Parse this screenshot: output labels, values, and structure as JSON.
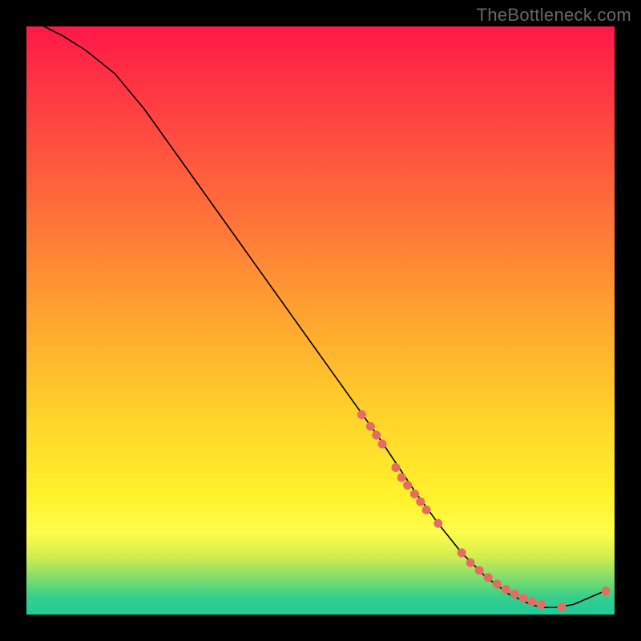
{
  "watermark": "TheBottleneck.com",
  "chart_data": {
    "type": "line",
    "title": "",
    "xlabel": "",
    "ylabel": "",
    "xlim": [
      0,
      100
    ],
    "ylim": [
      0,
      100
    ],
    "grid": false,
    "legend": false,
    "curve": {
      "x": [
        3,
        6,
        10,
        15,
        20,
        25,
        30,
        35,
        40,
        45,
        50,
        55,
        60,
        63,
        66,
        70,
        74,
        78,
        82,
        86,
        88,
        90,
        93,
        96,
        99
      ],
      "y": [
        100,
        98.5,
        96,
        92,
        86,
        79,
        72,
        65,
        58,
        51,
        44,
        37,
        30,
        25.5,
        21,
        15.5,
        10.5,
        6.5,
        3.5,
        1.6,
        1.2,
        1.2,
        1.7,
        3.0,
        4.3
      ]
    },
    "scatter_overlay": {
      "x": [
        57,
        58.5,
        59.5,
        60.5,
        62.8,
        63.8,
        64.8,
        66.0,
        67.0,
        68.0,
        70.0,
        74.0,
        75.5,
        77.0,
        78.5,
        80.0,
        81.5,
        83.0,
        84.5,
        86.0,
        87.5,
        91.0,
        98.5
      ],
      "y": [
        34.0,
        32.0,
        30.5,
        29.0,
        25.0,
        23.3,
        22.0,
        20.5,
        19.2,
        17.8,
        15.5,
        10.5,
        8.8,
        7.5,
        6.3,
        5.2,
        4.3,
        3.5,
        2.8,
        2.2,
        1.7,
        1.3,
        4.0
      ]
    },
    "colors": {
      "curve": "#000000",
      "dots": "#e86b63",
      "gradient_top": "#ff1848",
      "gradient_bottom": "#22c99b"
    }
  }
}
